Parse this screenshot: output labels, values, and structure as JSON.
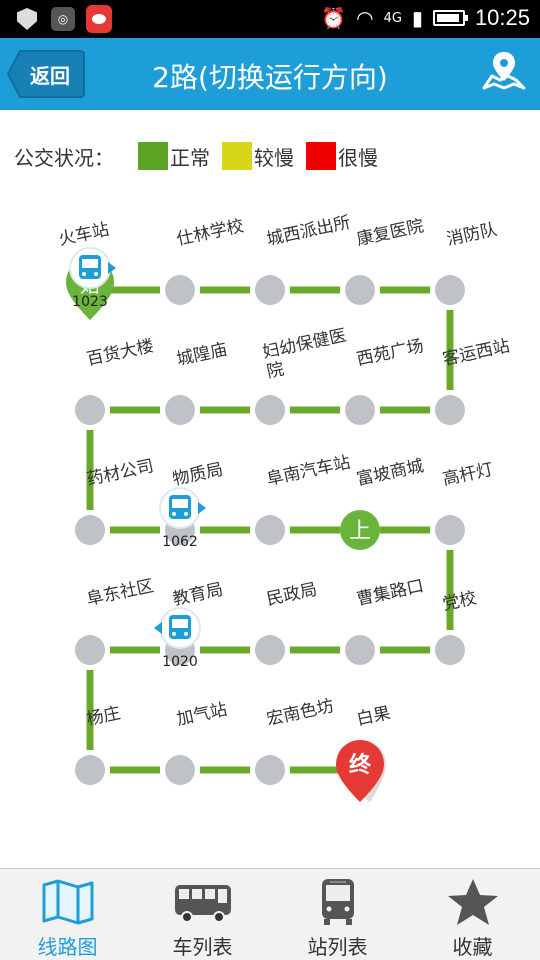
{
  "status_bar": {
    "time": "10:25",
    "network": "4G"
  },
  "header": {
    "back_label": "返回",
    "title": "2路(切换运行方向)"
  },
  "legend": {
    "label": "公交状况：",
    "items": [
      {
        "text": "正常",
        "color": "#5ba424"
      },
      {
        "text": "较慢",
        "color": "#d8d619"
      },
      {
        "text": "很慢",
        "color": "#f00000"
      }
    ]
  },
  "colors": {
    "accent": "#1e9ed8",
    "route": "#6aa82a",
    "stop": "#bfc3c8",
    "boarding": "#6ab43c",
    "terminal": "#e53935"
  },
  "route": {
    "stops": [
      {
        "name": "火车站"
      },
      {
        "name": "仕林学校"
      },
      {
        "name": "城西派出所"
      },
      {
        "name": "康复医院"
      },
      {
        "name": "消防队"
      },
      {
        "name": "客运西站"
      },
      {
        "name": "西苑广场"
      },
      {
        "name": "妇幼保健医院"
      },
      {
        "name": "城隍庙"
      },
      {
        "name": "百货大楼"
      },
      {
        "name": "药材公司"
      },
      {
        "name": "物质局"
      },
      {
        "name": "阜南汽车站"
      },
      {
        "name": "富坡商城"
      },
      {
        "name": "高杆灯"
      },
      {
        "name": "党校"
      },
      {
        "name": "曹集路口"
      },
      {
        "name": "民政局"
      },
      {
        "name": "教育局"
      },
      {
        "name": "阜东社区"
      },
      {
        "name": "杨庄"
      },
      {
        "name": "加气站"
      },
      {
        "name": "宏南色坊"
      },
      {
        "name": "白果"
      }
    ],
    "start_marker": "始",
    "boarding_marker": "上",
    "terminal_marker": "终",
    "buses": [
      {
        "number": "1023"
      },
      {
        "number": "1062"
      },
      {
        "number": "1020"
      }
    ]
  },
  "bottom_nav": {
    "items": [
      {
        "label": "线路图",
        "icon": "map-icon",
        "active": true
      },
      {
        "label": "车列表",
        "icon": "bus-side-icon",
        "active": false
      },
      {
        "label": "站列表",
        "icon": "bus-front-icon",
        "active": false
      },
      {
        "label": "收藏",
        "icon": "star-icon",
        "active": false
      }
    ]
  }
}
